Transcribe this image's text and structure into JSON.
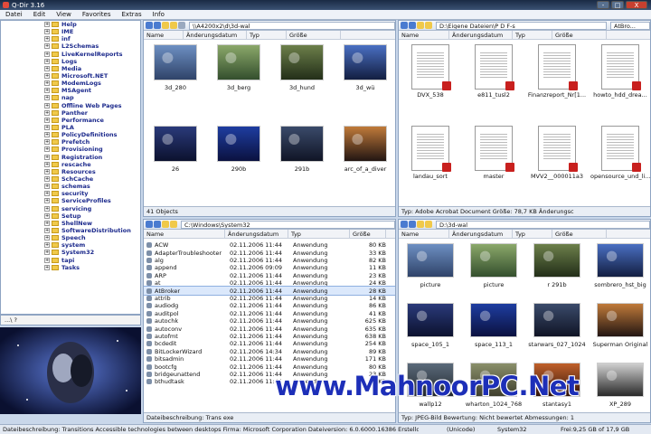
{
  "app": {
    "title": "Q-Dir 3.16",
    "window_controls": [
      "-",
      "□",
      "X"
    ]
  },
  "menu": [
    "Datei",
    "Edit",
    "View",
    "Favorites",
    "Extras",
    "Info"
  ],
  "tree": [
    "Help",
    "IME",
    "inf",
    "L2Schemas",
    "LiveKernelReports",
    "Logs",
    "Media",
    "Microsoft.NET",
    "ModemLogs",
    "MSAgent",
    "nap",
    "Offline Web Pages",
    "Panther",
    "Performance",
    "PLA",
    "PolicyDefinitions",
    "Prefetch",
    "Provisioning",
    "Registration",
    "rescache",
    "Resources",
    "SchCache",
    "schemas",
    "security",
    "ServiceProfiles",
    "servicing",
    "Setup",
    "ShellNew",
    "SoftwareDistribution",
    "Speech",
    "system",
    "System32",
    "tapi",
    "Tasks"
  ],
  "tree_path": "...\\ ?",
  "pane_tl": {
    "path": "\\\\A4200x2\\d\\3d-wal",
    "columns": [
      "Name",
      "Änderungsdatum",
      "Typ",
      "Größe"
    ],
    "items": [
      "3d_280",
      "3d_berg",
      "3d_hund",
      "3d_wü",
      "26",
      "290b",
      "291b",
      "arc_of_a_diver"
    ],
    "status": "41 Objects"
  },
  "pane_tr": {
    "path": "D:\\Eigene Dateien\\P D F-s",
    "columns": [
      "Name",
      "Änderungsdatum",
      "Typ",
      "Größe"
    ],
    "items": [
      "DVX_538",
      "e811_tusl2",
      "Finanzreport_Nr[1...",
      "howto_hdd_drea...",
      "landau_sort",
      "master",
      "MVV2__000011a3",
      "opensource_und_li..."
    ],
    "status": "Typ: Adobe Acrobat Document Größe: 78,7 KB Änderungsc"
  },
  "pane_bl": {
    "path": "C:\\Windows\\System32",
    "columns": [
      "Name",
      "Änderungsdatum",
      "Typ",
      "Größe"
    ],
    "rows": [
      [
        "ACW",
        "02.11.2006 11:44",
        "Anwendung",
        "80 KB"
      ],
      [
        "AdapterTroubleshooter",
        "02.11.2006 11:44",
        "Anwendung",
        "33 KB"
      ],
      [
        "alg",
        "02.11.2006 11:44",
        "Anwendung",
        "82 KB"
      ],
      [
        "append",
        "02.11.2006 09:09",
        "Anwendung",
        "11 KB"
      ],
      [
        "ARP",
        "02.11.2006 11:44",
        "Anwendung",
        "23 KB"
      ],
      [
        "at",
        "02.11.2006 11:44",
        "Anwendung",
        "24 KB"
      ],
      [
        "AtBroker",
        "02.11.2006 11:44",
        "Anwendung",
        "28 KB"
      ],
      [
        "attrib",
        "02.11.2006 11:44",
        "Anwendung",
        "14 KB"
      ],
      [
        "audiodg",
        "02.11.2006 11:44",
        "Anwendung",
        "86 KB"
      ],
      [
        "auditpol",
        "02.11.2006 11:44",
        "Anwendung",
        "41 KB"
      ],
      [
        "autochk",
        "02.11.2006 11:44",
        "Anwendung",
        "625 KB"
      ],
      [
        "autoconv",
        "02.11.2006 11:44",
        "Anwendung",
        "635 KB"
      ],
      [
        "autofmt",
        "02.11.2006 11:44",
        "Anwendung",
        "638 KB"
      ],
      [
        "bcdedit",
        "02.11.2006 11:44",
        "Anwendung",
        "254 KB"
      ],
      [
        "BitLockerWizard",
        "02.11.2006 14:34",
        "Anwendung",
        "89 KB"
      ],
      [
        "bitsadmin",
        "02.11.2006 11:44",
        "Anwendung",
        "171 KB"
      ],
      [
        "bootcfg",
        "02.11.2006 11:44",
        "Anwendung",
        "80 KB"
      ],
      [
        "bridgeunattend",
        "02.11.2006 11:44",
        "Anwendung",
        "23 KB"
      ],
      [
        "bthudtask",
        "02.11.2006 11:44",
        "Anwendung",
        "36 KB"
      ]
    ],
    "status": "Dateibeschreibung: Trans  exe"
  },
  "pane_br": {
    "path": "D:\\3d-wal",
    "columns": [
      "Name",
      "Änderungsdatum",
      "Typ",
      "Größe"
    ],
    "items": [
      "picture",
      "picture",
      "r 291b",
      "sombrero_hst_big",
      "space_105_1",
      "space_113_1",
      "starwars_027_1024",
      "Superman Original",
      "wallp12",
      "wharton_1024_768",
      "stantasy1",
      "XP_289"
    ],
    "status": "Typ: JPEG-Bild Bewertung: Nicht bewertet Abmessungen: 1"
  },
  "bottom_bar": {
    "desc": "Dateibeschreibung: Transitions Accessible technologies between desktops Firma: Microsoft Corporation Dateiversion: 6.0.6000.16386 Erstelldatum: 02.11.2006",
    "enc": "(Unicode)",
    "folder": "System32",
    "free": "Frei:9,25 GB of 17,9 GB"
  },
  "watermark": "www.MahnoorPC.Net",
  "misc": {
    "atbroker_label": "AtBro..."
  }
}
